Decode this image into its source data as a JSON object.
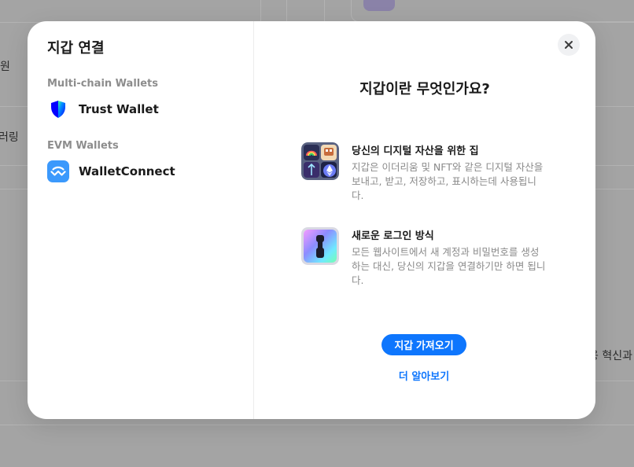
{
  "background": {
    "left_label_1": "원",
    "left_label_2": "러링",
    "right_label": "용 혁신과"
  },
  "modal": {
    "title": "지갑 연결",
    "groups": [
      {
        "label": "Multi-chain Wallets",
        "items": [
          {
            "name": "Trust Wallet",
            "icon": "trust-wallet-shield-icon"
          }
        ]
      },
      {
        "label": "EVM Wallets",
        "items": [
          {
            "name": "WalletConnect",
            "icon": "walletconnect-icon"
          }
        ]
      }
    ],
    "close_icon": "close-icon"
  },
  "info": {
    "title": "지갑이란 무엇인가요?",
    "features": [
      {
        "heading": "당신의 디지털 자산을 위한 집",
        "description": "지갑은 이더리움 및 NFT와 같은 디지털 자산을 보내고, 받고, 저장하고, 표시하는데 사용됩니다.",
        "icon": "digital-assets-icon"
      },
      {
        "heading": "새로운 로그인 방식",
        "description": "모든 웹사이트에서 새 계정과 비밀번호를 생성하는 대신, 당신의 지갑을 연결하기만 하면 됩니다.",
        "icon": "keyhole-login-icon"
      }
    ],
    "primary_button": "지갑 가져오기",
    "learn_more": "더 알아보기"
  },
  "colors": {
    "accent": "#0e76fd",
    "walletconnect": "#3b99fc",
    "trust_wallet": "#0500ff"
  }
}
